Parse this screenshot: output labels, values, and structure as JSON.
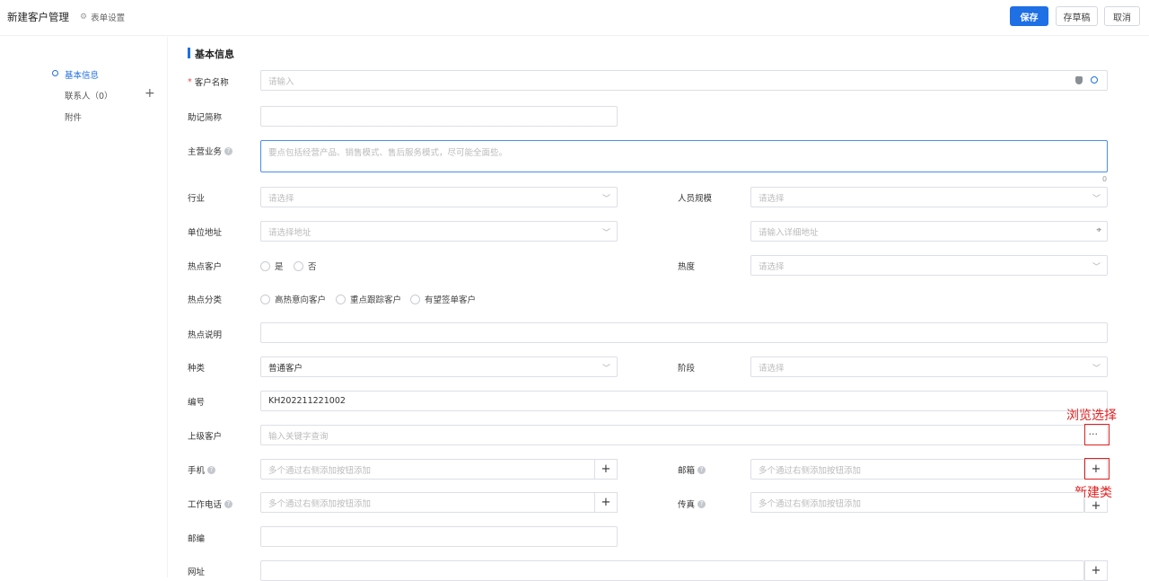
{
  "header": {
    "title": "新建客户管理",
    "form_settings": "表单设置",
    "save": "保存",
    "draft": "存草稿",
    "cancel": "取消"
  },
  "nav": {
    "basic_info": "基本信息",
    "contacts": "联系人（0）",
    "attachments": "附件"
  },
  "section": {
    "title": "基本信息"
  },
  "fields": {
    "customer_name": {
      "label": "客户名称",
      "placeholder": "请输入"
    },
    "mnemonic": {
      "label": "助记简称"
    },
    "main_business": {
      "label": "主营业务",
      "placeholder": "要点包括经营产品、销售模式、售后服务模式，尽可能全面些。",
      "count": "0"
    },
    "industry": {
      "label": "行业",
      "placeholder": "请选择"
    },
    "staff_size": {
      "label": "人员规模",
      "placeholder": "请选择"
    },
    "address": {
      "label": "单位地址",
      "placeholder": "请选择地址",
      "detail_placeholder": "请输入详细地址"
    },
    "hot_customer": {
      "label": "热点客户",
      "options": [
        "是",
        "否"
      ]
    },
    "heat": {
      "label": "热度",
      "placeholder": "请选择"
    },
    "hot_category": {
      "label": "热点分类",
      "options": [
        "高热意向客户",
        "重点跟踪客户",
        "有望签单客户"
      ]
    },
    "hot_desc": {
      "label": "热点说明"
    },
    "category": {
      "label": "种类",
      "value": "普通客户"
    },
    "stage": {
      "label": "阶段",
      "placeholder": "请选择"
    },
    "number": {
      "label": "编号",
      "value": "KH202211221002"
    },
    "parent_customer": {
      "label": "上级客户",
      "placeholder": "输入关键字查询",
      "browse": "···"
    },
    "mobile": {
      "label": "手机",
      "placeholder": "多个通过右侧添加按钮添加"
    },
    "email": {
      "label": "邮箱",
      "placeholder": "多个通过右侧添加按钮添加"
    },
    "work_phone": {
      "label": "工作电话",
      "placeholder": "多个通过右侧添加按钮添加"
    },
    "fax": {
      "label": "传真",
      "placeholder": "多个通过右侧添加按钮添加"
    },
    "postcode": {
      "label": "邮编"
    },
    "website": {
      "label": "网址"
    }
  },
  "annotations": {
    "browse": "浏览选择",
    "new_type": "新建类"
  },
  "colors": {
    "primary": "#1f6fe5",
    "annotation": "#e02020"
  }
}
